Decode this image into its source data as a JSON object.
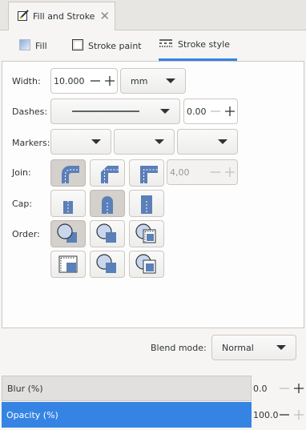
{
  "dialog": {
    "tab_label": "Fill and Stroke"
  },
  "tabs": {
    "fill": "Fill",
    "stroke_paint": "Stroke paint",
    "stroke_style": "Stroke style"
  },
  "stroke_style": {
    "width_label": "Width:",
    "width_value": "10.000",
    "unit": "mm",
    "dashes_label": "Dashes:",
    "dash_offset": "0.00",
    "markers_label": "Markers:",
    "join_label": "Join:",
    "miter_limit": "4,00",
    "cap_label": "Cap:",
    "order_label": "Order:"
  },
  "blend": {
    "label": "Blend mode:",
    "value": "Normal"
  },
  "blur": {
    "label": "Blur (%)",
    "value": "0.0"
  },
  "opacity": {
    "label": "Opacity (%)",
    "value": "100.0"
  },
  "colors": {
    "accent": "#3584e4",
    "active_button": "#d4d0cc",
    "shape_blue": "#5b7fb8"
  },
  "icons": [
    "pen-fill-icon",
    "close-icon",
    "fill-swatch-icon",
    "stroke-paint-icon",
    "stroke-style-icon",
    "minus-icon",
    "plus-icon",
    "chevron-down-icon",
    "join-round-icon",
    "join-bevel-icon",
    "join-miter-icon",
    "cap-butt-icon",
    "cap-round-icon",
    "cap-square-icon",
    "order-icon"
  ]
}
